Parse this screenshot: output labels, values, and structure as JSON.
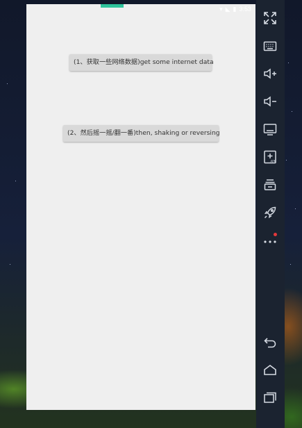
{
  "status_bar": {
    "time": "3:53"
  },
  "app": {
    "buttons": [
      {
        "label": "(1、获取一些网络数据)get some internet data"
      },
      {
        "label": "(2、然后摇一摇/翻一番)then, shaking or reversing"
      }
    ]
  },
  "emulator_toolbar": {
    "icons": [
      "fullscreen-icon",
      "keyboard-icon",
      "volume-up-icon",
      "volume-down-icon",
      "screen-icon",
      "apk-install-icon",
      "multi-window-icon",
      "rocket-icon",
      "more-icon",
      "back-icon",
      "home-icon",
      "recents-icon"
    ],
    "notification_color": "#e5383b"
  },
  "colors": {
    "accent": "#2fc39b",
    "toolbar_bg": "#1b2330",
    "screen_bg": "#efefef",
    "button_bg": "#d9d9d9"
  }
}
